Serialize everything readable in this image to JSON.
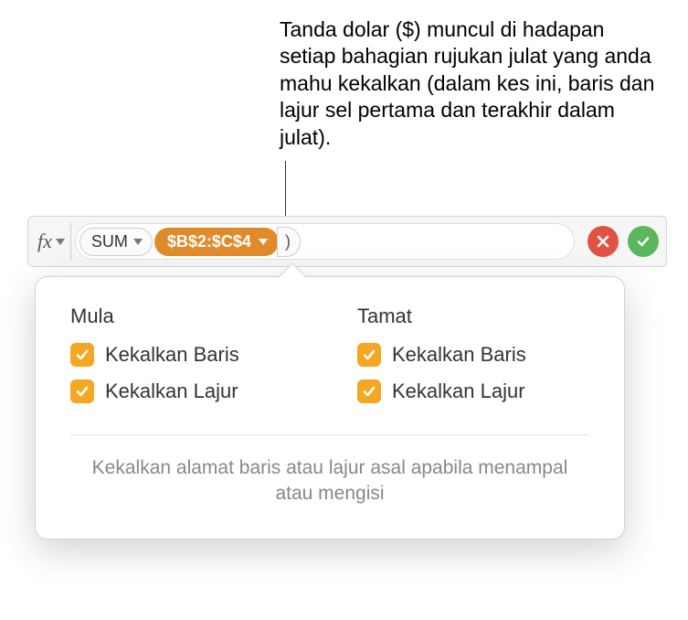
{
  "callout": {
    "text": "Tanda dolar ($) muncul di hadapan setiap bahagian rujukan julat yang anda mahu kekalkan (dalam kes ini, baris dan lajur sel pertama dan terakhir dalam julat)."
  },
  "formula_bar": {
    "fx_label": "fx",
    "function_name": "SUM",
    "range_ref": "$B$2:$C$4"
  },
  "popover": {
    "start_title": "Mula",
    "end_title": "Tamat",
    "preserve_row": "Kekalkan Baris",
    "preserve_col": "Kekalkan Lajur",
    "start_row_checked": true,
    "start_col_checked": true,
    "end_row_checked": true,
    "end_col_checked": true,
    "description": "Kekalkan alamat baris atau lajur asal apabila menampal atau mengisi"
  },
  "colors": {
    "accent_orange": "#e08a2b",
    "checkbox_orange": "#f5a623",
    "btn_red": "#e25242",
    "btn_green": "#5bb75b"
  }
}
